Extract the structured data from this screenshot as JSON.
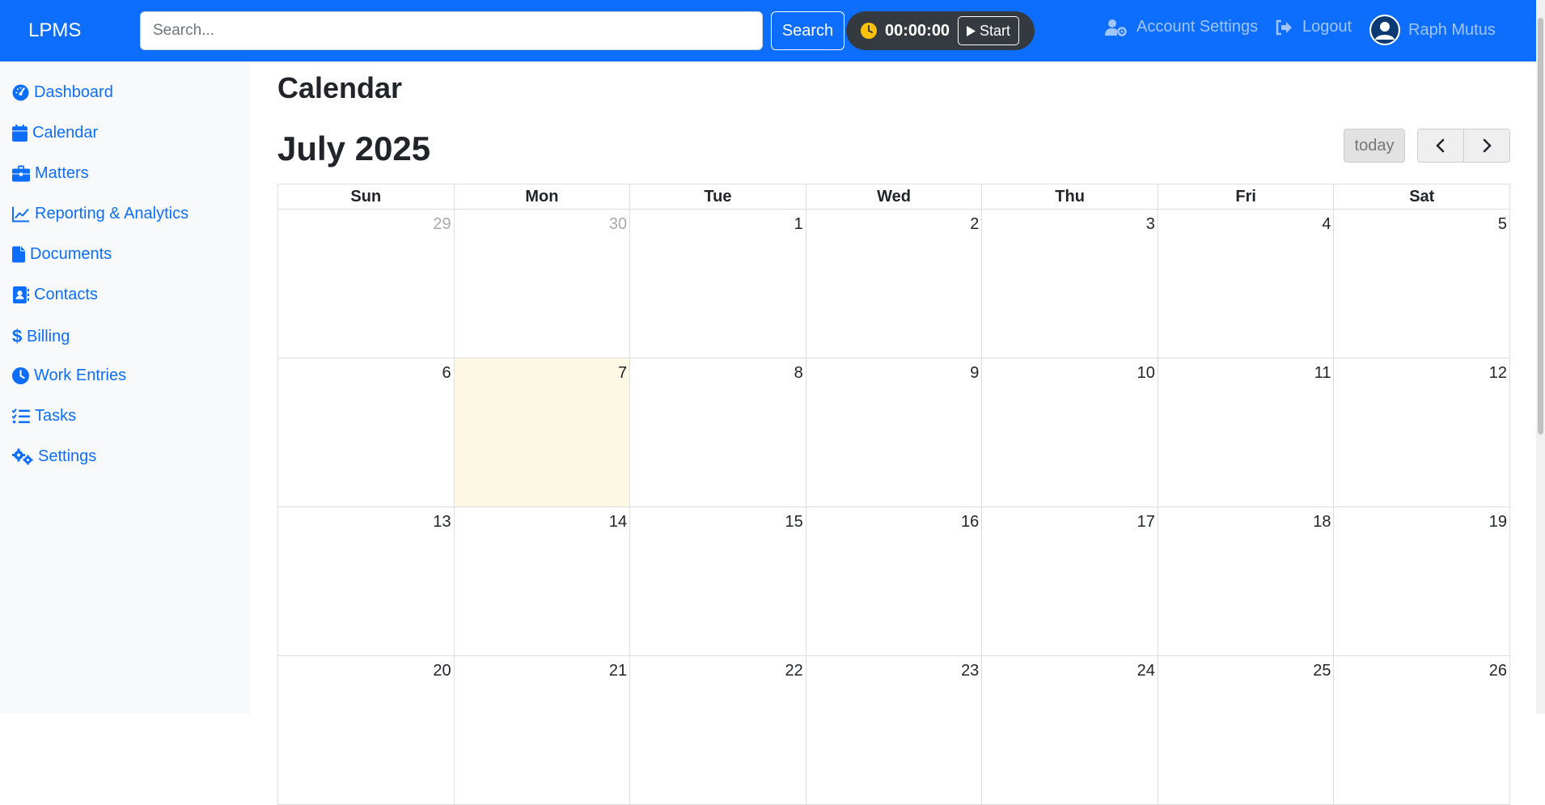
{
  "app": {
    "brand": "LPMS"
  },
  "search": {
    "placeholder": "Search...",
    "button_label": "Search"
  },
  "timer": {
    "time": "00:00:00",
    "start_label": "Start"
  },
  "nav": {
    "account_settings": "Account Settings",
    "logout": "Logout",
    "user_name": "Raph Mutus"
  },
  "sidebar": {
    "items": [
      {
        "label": "Dashboard",
        "icon": "tachometer-icon"
      },
      {
        "label": "Calendar",
        "icon": "calendar-icon"
      },
      {
        "label": "Matters",
        "icon": "briefcase-icon"
      },
      {
        "label": "Reporting & Analytics",
        "icon": "chart-line-icon"
      },
      {
        "label": "Documents",
        "icon": "file-icon"
      },
      {
        "label": "Contacts",
        "icon": "address-book-icon"
      },
      {
        "label": "Billing",
        "icon": "dollar-icon"
      },
      {
        "label": "Work Entries",
        "icon": "clock-icon"
      },
      {
        "label": "Tasks",
        "icon": "tasks-icon"
      },
      {
        "label": "Settings",
        "icon": "cogs-icon"
      }
    ]
  },
  "main": {
    "page_title": "Calendar",
    "month_title": "July 2025",
    "today_label": "today",
    "weekdays": [
      "Sun",
      "Mon",
      "Tue",
      "Wed",
      "Thu",
      "Fri",
      "Sat"
    ],
    "weeks": [
      [
        "29",
        "30",
        "1",
        "2",
        "3",
        "4",
        "5"
      ],
      [
        "6",
        "7",
        "8",
        "9",
        "10",
        "11",
        "12"
      ],
      [
        "13",
        "14",
        "15",
        "16",
        "17",
        "18",
        "19"
      ],
      [
        "20",
        "21",
        "22",
        "23",
        "24",
        "25",
        "26"
      ]
    ],
    "other_month_days": [
      "29",
      "30"
    ],
    "today_date": "7"
  },
  "colors": {
    "primary": "#0d6efd",
    "nav_muted": "#9ec5fe",
    "sidebar_bg": "#f8f9fa",
    "today_highlight": "#fcf8e3",
    "timer_bg": "#343a40",
    "clock_icon": "#ffc107"
  }
}
